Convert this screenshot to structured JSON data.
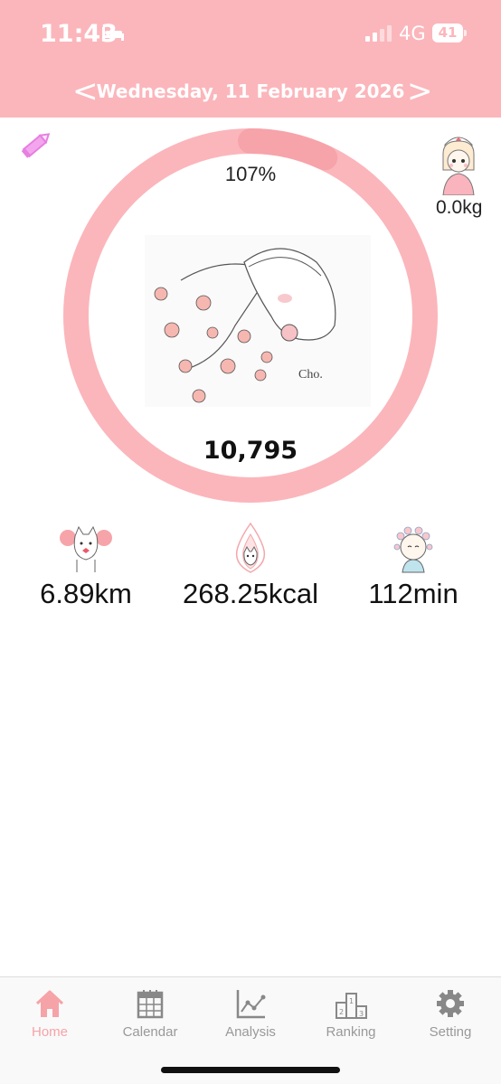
{
  "status_bar": {
    "time": "11:43",
    "network": "4G",
    "battery": "41",
    "icons": [
      "bed-icon",
      "signal-icon",
      "battery-icon"
    ]
  },
  "date_nav": {
    "prev_label": "<",
    "date": "Wednesday, 11 February 2026",
    "next_label": ">"
  },
  "progress": {
    "percent_label": "107%",
    "fraction": 1.07,
    "steps": "10,795"
  },
  "weight": "0.0kg",
  "stats": {
    "distance": "6.89km",
    "calories": "268.25kcal",
    "time": "112min"
  },
  "tabs": [
    {
      "label": "Home",
      "icon": "home-icon",
      "active": true
    },
    {
      "label": "Calendar",
      "icon": "calendar-icon",
      "active": false
    },
    {
      "label": "Analysis",
      "icon": "analysis-icon",
      "active": false
    },
    {
      "label": "Ranking",
      "icon": "ranking-icon",
      "active": false
    },
    {
      "label": "Setting",
      "icon": "gear-icon",
      "active": false
    }
  ],
  "colors": {
    "accent": "#fbb6bb",
    "tab_active": "#f6a3a8",
    "edit_icon": "#e77fe0"
  }
}
